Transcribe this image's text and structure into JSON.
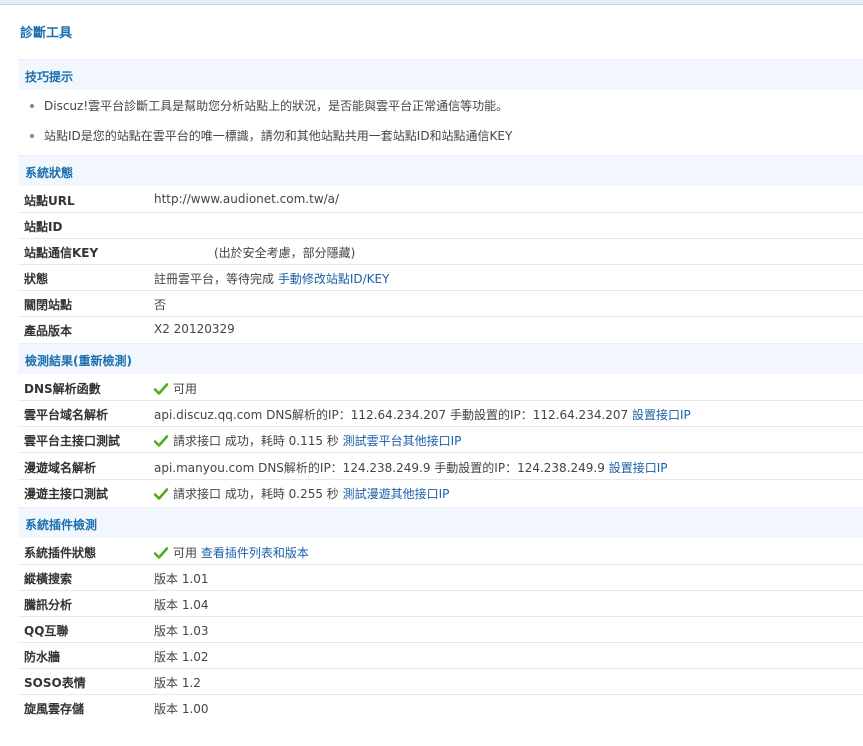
{
  "page": {
    "title": "診斷工具"
  },
  "tips": {
    "header": "技巧提示",
    "items": [
      "Discuz!雲平台診斷工具是幫助您分析站點上的狀況，是否能與雲平台正常通信等功能。",
      "站點ID是您的站點在雲平台的唯一標識，請勿和其他站點共用一套站點ID和站點通信KEY"
    ]
  },
  "system_status": {
    "header": "系統狀態",
    "site_url": {
      "label": "站點URL",
      "value": "http://www.audionet.com.tw/a/"
    },
    "site_id": {
      "label": "站點ID",
      "value": ""
    },
    "site_key": {
      "label": "站點通信KEY",
      "value": "(出於安全考慮，部分隱藏)"
    },
    "status": {
      "label": "狀態",
      "value": "註冊雲平台，等待完成",
      "link": "手動修改站點ID/KEY"
    },
    "closed": {
      "label": "關閉站點",
      "value": "否"
    },
    "version": {
      "label": "產品版本",
      "value": "X2 20120329"
    }
  },
  "check_results": {
    "header": "檢測結果(重新檢測)",
    "dns_func": {
      "label": "DNS解析函數",
      "value": "可用"
    },
    "cloud_domain": {
      "label": "雲平台域名解析",
      "value": "api.discuz.qq.com DNS解析的IP：112.64.234.207 手動設置的IP：112.64.234.207",
      "link": "設置接口IP"
    },
    "cloud_api": {
      "label": "雲平台主接口測試",
      "value": "請求接口 成功，耗時 0.115 秒",
      "link": "測試雲平台其他接口IP"
    },
    "manyou_domain": {
      "label": "漫遊域名解析",
      "value": "api.manyou.com DNS解析的IP：124.238.249.9 手動設置的IP：124.238.249.9",
      "link": "設置接口IP"
    },
    "manyou_api": {
      "label": "漫遊主接口測試",
      "value": "請求接口 成功，耗時 0.255 秒",
      "link": "測試漫遊其他接口IP"
    }
  },
  "plugin_check": {
    "header": "系統插件檢測",
    "status": {
      "label": "系統插件狀態",
      "value": "可用",
      "link": "查看插件列表和版本"
    },
    "plugins": [
      {
        "label": "縱橫搜索",
        "value": "版本 1.01"
      },
      {
        "label": "騰訊分析",
        "value": "版本 1.04"
      },
      {
        "label": "QQ互聯",
        "value": "版本 1.03"
      },
      {
        "label": "防水牆",
        "value": "版本 1.02"
      },
      {
        "label": "SOSO表情",
        "value": "版本 1.2"
      },
      {
        "label": "旋風雲存儲",
        "value": "版本 1.00"
      }
    ]
  },
  "colors": {
    "link": "#1b5fa8",
    "header_text": "#1b6fae",
    "section_bg": "#f1f7fd",
    "check": "#4caf1a"
  }
}
